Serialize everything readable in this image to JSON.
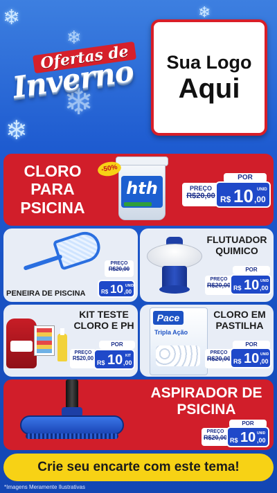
{
  "header": {
    "badge_top": "Ofertas de",
    "badge_main": "Inverno",
    "logo_line1": "Sua Logo",
    "logo_line2": "Aqui"
  },
  "cloro": {
    "title_line1": "CLORO",
    "title_line2": "PARA",
    "title_line3": "PSICINA",
    "discount": "-50%",
    "brand": "hth",
    "por": "POR",
    "preco": "PREÇO",
    "old_price": "R$20,00",
    "currency": "R$",
    "price_int": "10",
    "price_dec": ",00",
    "unit": "UNID"
  },
  "peneira": {
    "title": "PENEIRA DE PISCINA",
    "preco": "PREÇO",
    "old_price": "R$20,00",
    "currency": "R$",
    "price_int": "10",
    "price_dec": ",00",
    "unit": "UNID"
  },
  "flutuador": {
    "title_line1": "FLUTUADOR",
    "title_line2": "QUIMICO",
    "por": "POR",
    "preco": "PREÇO",
    "old_price": "R$20,00",
    "currency": "R$",
    "price_int": "10",
    "price_dec": ",00",
    "unit": "UNID"
  },
  "kit": {
    "title_line1": "KIT TESTE",
    "title_line2": "CLORO E PH",
    "por": "POR",
    "preco": "PREÇO",
    "old_price": "R$20,00",
    "currency": "R$",
    "price_int": "10",
    "price_dec": ",00",
    "unit": "KIT"
  },
  "pastilha": {
    "title_line1": "CLORO EM",
    "title_line2": "PASTILHA",
    "brand": "Pace",
    "package_text": "Tripla Ação",
    "por": "POR",
    "preco": "PREÇO",
    "old_price": "R$20,00",
    "currency": "R$",
    "price_int": "10",
    "price_dec": ",00",
    "unit": "UNID"
  },
  "aspirador": {
    "title_line1": "ASPIRADOR DE",
    "title_line2": "PSICINA",
    "por": "POR",
    "preco": "PREÇO",
    "old_price": "R$20,00",
    "currency": "R$",
    "price_int": "10",
    "price_dec": ",00",
    "unit": "UNID"
  },
  "footer": {
    "cta": "Crie seu encarte com este tema!",
    "disclaimer": "*Imagens Meramente Ilustrativas"
  },
  "colors": {
    "background": "#1e5bd0",
    "card_red": "#d11e2a",
    "price_blue": "#1f49c9",
    "cta_yellow": "#f7d215"
  }
}
